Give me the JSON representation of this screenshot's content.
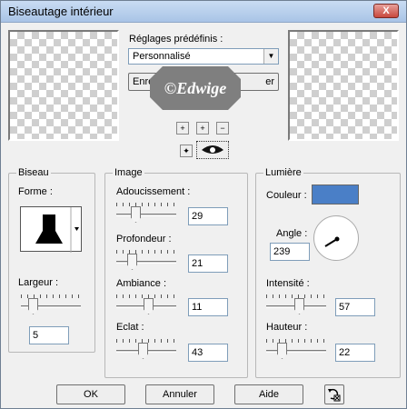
{
  "window": {
    "title": "Biseautage intérieur",
    "close": "X"
  },
  "presets": {
    "label": "Réglages prédéfinis :",
    "selected": "Personnalisé",
    "save_label": "Enre",
    "delete_label": "er"
  },
  "watermark": {
    "text": "©Edwige"
  },
  "tools": {
    "zoom_in": "+",
    "fit": "+",
    "zoom_out": "−",
    "move": "✦"
  },
  "bevel": {
    "group_title": "Biseau",
    "shape_label": "Forme :",
    "width_label": "Largeur :",
    "width_value": "5",
    "width_level": 0.15
  },
  "image": {
    "group_title": "Image",
    "sliders": [
      {
        "label": "Adoucissement :",
        "value": "29",
        "level": 0.29
      },
      {
        "label": "Profondeur :",
        "value": "21",
        "level": 0.21
      },
      {
        "label": "Ambiance :",
        "value": "11",
        "level": 0.55
      },
      {
        "label": "Eclat :",
        "value": "43",
        "level": 0.43
      }
    ]
  },
  "light": {
    "group_title": "Lumière",
    "color_label": "Couleur :",
    "color": "#4a7fc7",
    "angle_label": "Angle :",
    "angle_value": "239",
    "intensity_label": "Intensité :",
    "intensity_value": "57",
    "intensity_level": 0.57,
    "height_label": "Hauteur :",
    "height_value": "22",
    "height_level": 0.22
  },
  "buttons": {
    "ok": "OK",
    "cancel": "Annuler",
    "help": "Aide"
  },
  "colors": {
    "titlebar": "#b6cdeb",
    "dialog_bg": "#f0f0f0"
  }
}
